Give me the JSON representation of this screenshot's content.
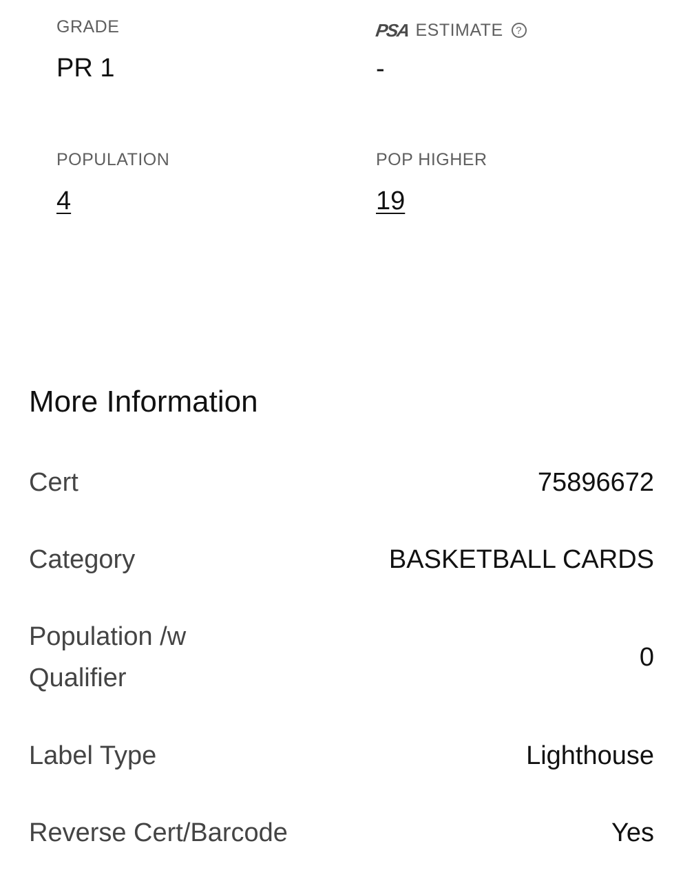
{
  "stats": {
    "grade": {
      "label": "GRADE",
      "value": "PR 1"
    },
    "estimate": {
      "logo": "PSA",
      "label": "ESTIMATE",
      "help_icon": "?",
      "value": "-"
    },
    "population": {
      "label": "POPULATION",
      "value": "4"
    },
    "pop_higher": {
      "label": "POP HIGHER",
      "value": "19"
    }
  },
  "more_info": {
    "title": "More Information",
    "rows": [
      {
        "label": "Cert",
        "value": "75896672"
      },
      {
        "label": "Category",
        "value": "BASKETBALL CARDS"
      },
      {
        "label": "Population /w Qualifier",
        "value": "0"
      },
      {
        "label": "Label Type",
        "value": "Lighthouse"
      },
      {
        "label": "Reverse Cert/Barcode",
        "value": "Yes"
      }
    ]
  }
}
